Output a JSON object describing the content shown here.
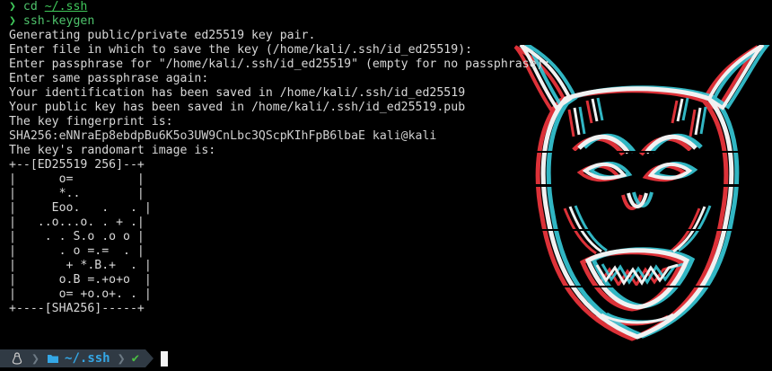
{
  "session": {
    "prompt_symbol": "❯",
    "commands": [
      {
        "text": "cd ",
        "arg": "~/.ssh"
      },
      {
        "text": "ssh-keygen",
        "arg": ""
      }
    ],
    "output_lines": [
      "Generating public/private ed25519 key pair.",
      "Enter file in which to save the key (/home/kali/.ssh/id_ed25519):",
      "Enter passphrase for \"/home/kali/.ssh/id_ed25519\" (empty for no passphrase):",
      "Enter same passphrase again:",
      "Your identification has been saved in /home/kali/.ssh/id_ed25519",
      "Your public key has been saved in /home/kali/.ssh/id_ed25519.pub",
      "The key fingerprint is:"
    ],
    "fingerprint": "SHA256:eNNraEp8ebdpBu6K5o3UW9CnLbc3QScpKIhFpB6lbaE kali@kali",
    "randomart_intro": "The key's randomart image is:",
    "randomart": [
      "+--[ED25519 256]--+",
      "|      o=         |",
      "|      *..        |",
      "|     Eoo.   .   . |",
      "|   ..o...o. . + .|",
      "|    . . S.o .o o |",
      "|      . o =.=  . |",
      "|       + *.B.+  . |",
      "|      o.B =.+o+o  |",
      "|      o= +o.o+. . |",
      "+----[SHA256]-----+"
    ]
  },
  "statusbar": {
    "os_icon": "linux-tux-icon",
    "separator": "❯",
    "folder_icon": "folder-icon",
    "directory": "~/.ssh",
    "status_check": "✔",
    "colors": {
      "segment_bg": "#303a44",
      "directory": "#34a7e6",
      "ok": "#4bbf42"
    }
  },
  "wallpaper": {
    "icon": "hannya-mask-glitch-icon",
    "colors": {
      "red": "#e8343b",
      "cyan": "#3ad6e6",
      "white": "#f1f1f1"
    }
  }
}
